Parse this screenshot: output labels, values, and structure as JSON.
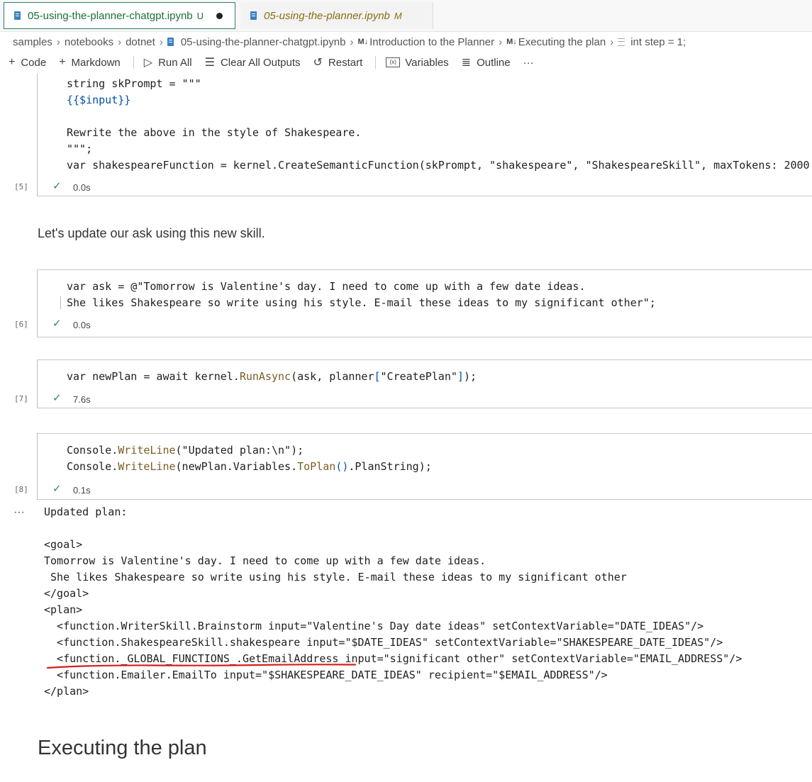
{
  "tabs": [
    {
      "label": "05-using-the-planner-chatgpt.ipynb",
      "status": "U",
      "dirty": true
    },
    {
      "label": "05-using-the-planner.ipynb",
      "status": "M",
      "dirty": false
    }
  ],
  "breadcrumb": {
    "items": [
      "samples",
      "notebooks",
      "dotnet",
      "05-using-the-planner-chatgpt.ipynb",
      "Introduction to the Planner",
      "Executing the plan",
      "int step = 1;"
    ],
    "md_marker": "M↓"
  },
  "toolbar": {
    "code": "Code",
    "markdown": "Markdown",
    "run_all": "Run All",
    "clear_all_outputs": "Clear All Outputs",
    "restart": "Restart",
    "variables": "Variables",
    "outline": "Outline",
    "more": "···"
  },
  "cell5": {
    "lines": [
      "string skPrompt = \"\"\"",
      "{{$input}}",
      "",
      "Rewrite the above in the style of Shakespeare.",
      "\"\"\";",
      "var shakespeareFunction = kernel.CreateSemanticFunction(skPrompt, \"shakespeare\", \"ShakespeareSkill\", maxTokens: 2000"
    ],
    "exec": "[5]",
    "time": "0.0s"
  },
  "markdown1": "Let's update our ask using this new skill.",
  "cell6": {
    "line1": "var ask = @\"Tomorrow is Valentine's day. I need to come up with a few date ideas.",
    "line2": "She likes Shakespeare so write using his style. E-mail these ideas to my significant other\";",
    "exec": "[6]",
    "time": "0.0s"
  },
  "cell7": {
    "pre": "var newPlan = await kernel.",
    "method": "RunAsync",
    "mid": "(ask, planner",
    "bracket_open": "[",
    "arg": "\"CreatePlan\"",
    "bracket_close": "]",
    "post": ");",
    "exec": "[7]",
    "time": "7.6s"
  },
  "cell8": {
    "l1_pre": "Console.",
    "l1_method": "WriteLine",
    "l1_args": "(\"Updated plan:\\n\");",
    "l2_pre": "Console.",
    "l2_method": "WriteLine",
    "l2_args_a": "(newPlan.Variables.",
    "l2_method2": "ToPlan",
    "l2_paren": "()",
    "l2_args_b": ".PlanString);",
    "exec": "[8]",
    "time": "0.1s"
  },
  "output": {
    "ellipsis": "···",
    "lines": [
      "Updated plan:",
      "",
      "<goal>",
      "Tomorrow is Valentine's day. I need to come up with a few date ideas.",
      " She likes Shakespeare so write using his style. E-mail these ideas to my significant other",
      "</goal>",
      "<plan>",
      "  <function.WriterSkill.Brainstorm input=\"Valentine's Day date ideas\" setContextVariable=\"DATE_IDEAS\"/>",
      "  <function.ShakespeareSkill.shakespeare input=\"$DATE_IDEAS\" setContextVariable=\"SHAKESPEARE_DATE_IDEAS\"/>",
      "  <function._GLOBAL_FUNCTIONS_.GetEmailAddress input=\"significant other\" setContextVariable=\"EMAIL_ADDRESS\"/>",
      "  <function.Emailer.EmailTo input=\"$SHAKESPEARE_DATE_IDEAS\" recipient=\"$EMAIL_ADDRESS\"/>",
      "</plan>"
    ],
    "annotation_color": "#d21f1f"
  },
  "heading": "Executing the plan",
  "colors": {
    "success_check": "#2f8b4b",
    "active_tab_border": "#2e7d6b",
    "untracked_green": "#1b6f3a",
    "modified_gold": "#8a6d12"
  }
}
